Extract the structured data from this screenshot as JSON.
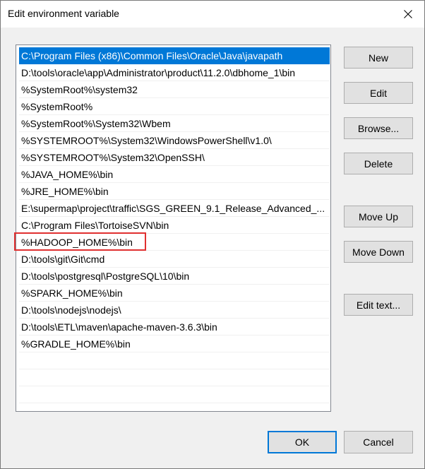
{
  "window": {
    "title": "Edit environment variable"
  },
  "path_list": {
    "selected_index": 0,
    "highlighted_index": 10,
    "items": [
      "C:\\Program Files (x86)\\Common Files\\Oracle\\Java\\javapath",
      "D:\\tools\\oracle\\app\\Administrator\\product\\11.2.0\\dbhome_1\\bin",
      "%SystemRoot%\\system32",
      "%SystemRoot%",
      "%SystemRoot%\\System32\\Wbem",
      "%SYSTEMROOT%\\System32\\WindowsPowerShell\\v1.0\\",
      "%SYSTEMROOT%\\System32\\OpenSSH\\",
      "%JAVA_HOME%\\bin",
      "%JRE_HOME%\\bin",
      "E:\\supermap\\project\\traffic\\SGS_GREEN_9.1_Release_Advanced_...",
      "C:\\Program Files\\TortoiseSVN\\bin",
      "%HADOOP_HOME%\\bin",
      "D:\\tools\\git\\Git\\cmd",
      "D:\\tools\\postgresql\\PostgreSQL\\10\\bin",
      "%SPARK_HOME%\\bin",
      "D:\\tools\\nodejs\\nodejs\\",
      "D:\\tools\\ETL\\maven\\apache-maven-3.6.3\\bin",
      "%GRADLE_HOME%\\bin"
    ]
  },
  "buttons": {
    "new": "New",
    "edit": "Edit",
    "browse": "Browse...",
    "delete": "Delete",
    "move_up": "Move Up",
    "move_down": "Move Down",
    "edit_text": "Edit text...",
    "ok": "OK",
    "cancel": "Cancel"
  },
  "colors": {
    "selection": "#0078d7",
    "highlight_box": "#e03030"
  }
}
